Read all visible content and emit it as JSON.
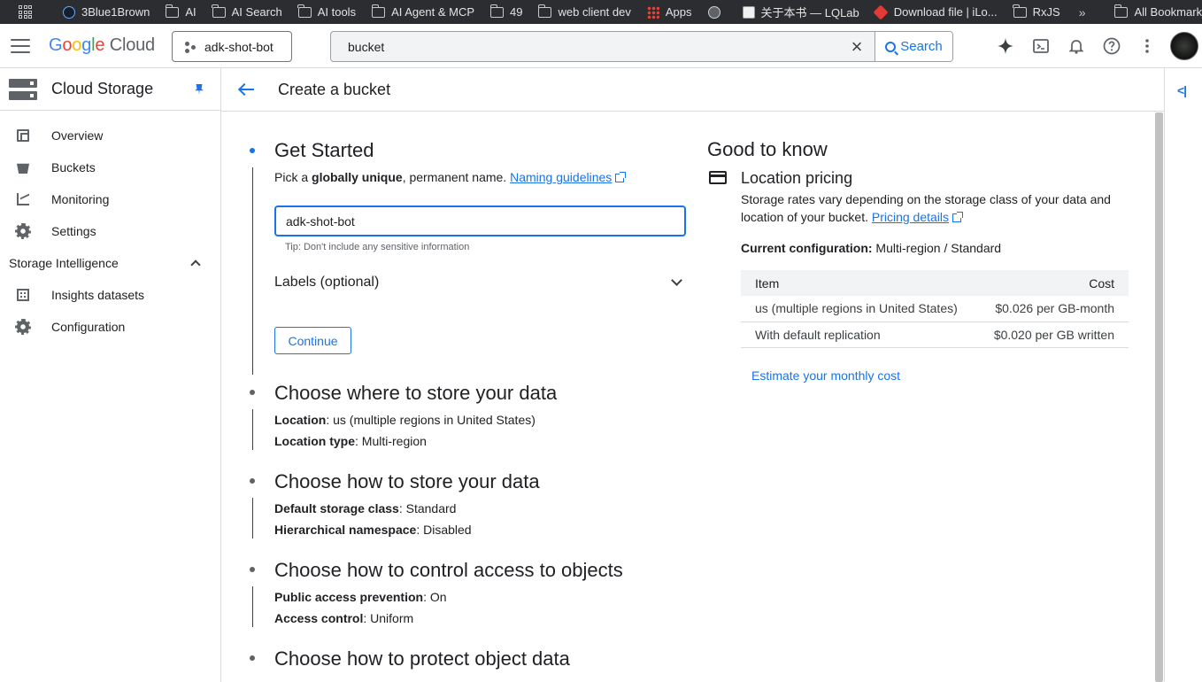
{
  "bookmarks": [
    {
      "label": "3Blue1Brown",
      "icon": "round"
    },
    {
      "label": "AI",
      "icon": "folder"
    },
    {
      "label": "AI Search",
      "icon": "folder"
    },
    {
      "label": "AI tools",
      "icon": "folder"
    },
    {
      "label": "AI Agent & MCP",
      "icon": "folder"
    },
    {
      "label": "49",
      "icon": "folder"
    },
    {
      "label": "web client dev",
      "icon": "folder"
    },
    {
      "label": "Apps",
      "icon": "apps"
    },
    {
      "label": "",
      "icon": "globe"
    },
    {
      "label": "关于本书 — LQLab",
      "icon": "img"
    },
    {
      "label": "Download file | iLo...",
      "icon": "heart"
    },
    {
      "label": "RxJS",
      "icon": "folder"
    }
  ],
  "bookmarks_more": "»",
  "all_bookmarks": "All Bookmarks",
  "header": {
    "logo_google": "Google",
    "logo_cloud": "Cloud",
    "project": "adk-shot-bot",
    "search_value": "bucket",
    "search_button": "Search"
  },
  "sidebar": {
    "title": "Cloud Storage",
    "items": [
      {
        "label": "Overview"
      },
      {
        "label": "Buckets"
      },
      {
        "label": "Monitoring"
      },
      {
        "label": "Settings"
      }
    ],
    "section": "Storage Intelligence",
    "section_items": [
      {
        "label": "Insights datasets"
      },
      {
        "label": "Configuration"
      }
    ]
  },
  "page": {
    "title": "Create a bucket"
  },
  "steps": {
    "get_started": {
      "title": "Get Started",
      "intro_pre": "Pick a ",
      "intro_bold": "globally unique",
      "intro_post": ", permanent name. ",
      "naming_link": "Naming guidelines",
      "name_value": "adk-shot-bot",
      "tip": "Tip: Don't include any sensitive information",
      "labels": "Labels (optional)",
      "continue": "Continue"
    },
    "where": {
      "title": "Choose where to store your data",
      "l1_key": "Location",
      "l1_val": ": us (multiple regions in United States)",
      "l2_key": "Location type",
      "l2_val": ": Multi-region"
    },
    "how": {
      "title": "Choose how to store your data",
      "l1_key": "Default storage class",
      "l1_val": ": Standard",
      "l2_key": "Hierarchical namespace",
      "l2_val": ": Disabled"
    },
    "access": {
      "title": "Choose how to control access to objects",
      "l1_key": "Public access prevention",
      "l1_val": ": On",
      "l2_key": "Access control",
      "l2_val": ": Uniform"
    },
    "protect": {
      "title": "Choose how to protect object data"
    }
  },
  "good_to_know": {
    "title": "Good to know",
    "pricing_title": "Location pricing",
    "pricing_text": "Storage rates vary depending on the storage class of your data and location of your bucket. ",
    "pricing_link": "Pricing details",
    "config_label": "Current configuration:",
    "config_value": " Multi-region / Standard",
    "table_headers": [
      "Item",
      "Cost"
    ],
    "table_rows": [
      [
        "us (multiple regions in United States)",
        "$0.026 per GB-month"
      ],
      [
        "With default replication",
        "$0.020 per GB written"
      ]
    ],
    "estimate": "Estimate your monthly cost"
  }
}
